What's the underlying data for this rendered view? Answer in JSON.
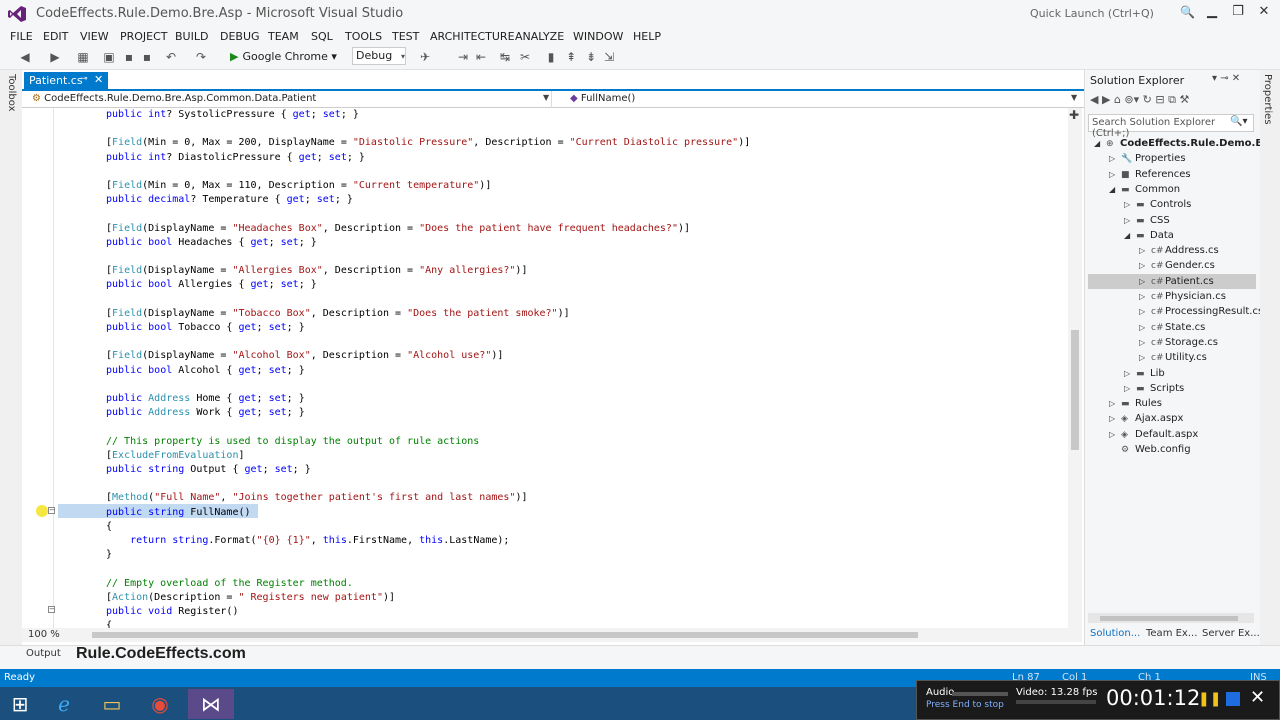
{
  "window": {
    "title": "CodeEffects.Rule.Demo.Bre.Asp - Microsoft Visual Studio",
    "quick_launch_placeholder": "Quick Launch (Ctrl+Q)"
  },
  "menu": [
    "FILE",
    "EDIT",
    "VIEW",
    "PROJECT",
    "BUILD",
    "DEBUG",
    "TEAM",
    "SQL",
    "TOOLS",
    "TEST",
    "ARCHITECTURE",
    "ANALYZE",
    "WINDOW",
    "HELP"
  ],
  "toolbar": {
    "run_target": "Google Chrome",
    "configuration": "Debug"
  },
  "left_tab": "Toolbox",
  "right_tab": "Properties",
  "editor": {
    "tab_label": "Patient.cs",
    "nav_left": "CodeEffects.Rule.Demo.Bre.Asp.Common.Data.Patient",
    "nav_right": "FullName()",
    "zoom": "100 %"
  },
  "code_lines": [
    {
      "text": "public int? SystolicPressure { get; set; }"
    },
    {
      "text": ""
    },
    {
      "text": "[Field(Min = 0, Max = 200, DisplayName = \"Diastolic Pressure\", Description = \"Current Diastolic pressure\")]"
    },
    {
      "text": "public int? DiastolicPressure { get; set; }"
    },
    {
      "text": ""
    },
    {
      "text": "[Field(Min = 0, Max = 110, Description = \"Current temperature\")]"
    },
    {
      "text": "public decimal? Temperature { get; set; }"
    },
    {
      "text": ""
    },
    {
      "text": "[Field(DisplayName = \"Headaches Box\", Description = \"Does the patient have frequent headaches?\")]"
    },
    {
      "text": "public bool Headaches { get; set; }"
    },
    {
      "text": ""
    },
    {
      "text": "[Field(DisplayName = \"Allergies Box\", Description = \"Any allergies?\")]"
    },
    {
      "text": "public bool Allergies { get; set; }"
    },
    {
      "text": ""
    },
    {
      "text": "[Field(DisplayName = \"Tobacco Box\", Description = \"Does the patient smoke?\")]"
    },
    {
      "text": "public bool Tobacco { get; set; }"
    },
    {
      "text": ""
    },
    {
      "text": "[Field(DisplayName = \"Alcohol Box\", Description = \"Alcohol use?\")]"
    },
    {
      "text": "public bool Alcohol { get; set; }"
    },
    {
      "text": ""
    },
    {
      "text": "public Address Home { get; set; }"
    },
    {
      "text": "public Address Work { get; set; }"
    },
    {
      "text": ""
    },
    {
      "text": "// This property is used to display the output of rule actions"
    },
    {
      "text": "[ExcludeFromEvaluation]"
    },
    {
      "text": "public string Output { get; set; }"
    },
    {
      "text": ""
    },
    {
      "text": "[Method(\"Full Name\", \"Joins together patient's first and last names\")]"
    },
    {
      "text": "public string FullName()"
    },
    {
      "text": "{"
    },
    {
      "text": "    return string.Format(\"{0} {1}\", this.FirstName, this.LastName);"
    },
    {
      "text": "}"
    },
    {
      "text": ""
    },
    {
      "text": "// Empty overload of the Register method."
    },
    {
      "text": "[Action(Description = \" Registers new patient\")]"
    },
    {
      "text": "public void Register()"
    },
    {
      "text": "{"
    }
  ],
  "solution_explorer": {
    "title": "Solution Explorer",
    "search_placeholder": "Search Solution Explorer (Ctrl+;)",
    "tree": [
      {
        "label": "CodeEffects.Rule.Demo.Bre.Asp",
        "level": 0,
        "arrow": "◢",
        "icon": "⊕",
        "bold": true
      },
      {
        "label": "Properties",
        "level": 1,
        "arrow": "▷",
        "icon": "🔧"
      },
      {
        "label": "References",
        "level": 1,
        "arrow": "▷",
        "icon": "■"
      },
      {
        "label": "Common",
        "level": 1,
        "arrow": "◢",
        "icon": "▬"
      },
      {
        "label": "Controls",
        "level": 2,
        "arrow": "▷",
        "icon": "▬"
      },
      {
        "label": "CSS",
        "level": 2,
        "arrow": "▷",
        "icon": "▬"
      },
      {
        "label": "Data",
        "level": 2,
        "arrow": "◢",
        "icon": "▬"
      },
      {
        "label": "Address.cs",
        "level": 3,
        "arrow": "▷",
        "icon": "c#"
      },
      {
        "label": "Gender.cs",
        "level": 3,
        "arrow": "▷",
        "icon": "c#"
      },
      {
        "label": "Patient.cs",
        "level": 3,
        "arrow": "▷",
        "icon": "c#",
        "selected": true
      },
      {
        "label": "Physician.cs",
        "level": 3,
        "arrow": "▷",
        "icon": "c#"
      },
      {
        "label": "ProcessingResult.cs",
        "level": 3,
        "arrow": "▷",
        "icon": "c#"
      },
      {
        "label": "State.cs",
        "level": 3,
        "arrow": "▷",
        "icon": "c#"
      },
      {
        "label": "Storage.cs",
        "level": 3,
        "arrow": "▷",
        "icon": "c#"
      },
      {
        "label": "Utility.cs",
        "level": 3,
        "arrow": "▷",
        "icon": "c#"
      },
      {
        "label": "Lib",
        "level": 2,
        "arrow": "▷",
        "icon": "▬"
      },
      {
        "label": "Scripts",
        "level": 2,
        "arrow": "▷",
        "icon": "▬"
      },
      {
        "label": "Rules",
        "level": 1,
        "arrow": "▷",
        "icon": "▬"
      },
      {
        "label": "Ajax.aspx",
        "level": 1,
        "arrow": "▷",
        "icon": "◈"
      },
      {
        "label": "Default.aspx",
        "level": 1,
        "arrow": "▷",
        "icon": "◈"
      },
      {
        "label": "Web.config",
        "level": 1,
        "arrow": "",
        "icon": "⚙"
      }
    ],
    "bottom_tabs": [
      "Solution...",
      "Team Ex...",
      "Server Ex..."
    ]
  },
  "output": {
    "tab_label": "Output",
    "banner": "Rule.CodeEffects.com"
  },
  "status": {
    "text": "Ready",
    "ln": "Ln 87",
    "col": "Col 1",
    "ch": "Ch 1",
    "mode": "INS"
  },
  "recorder": {
    "audio_label": "Audio",
    "video_label": "Video: 13.28 fps",
    "hint": "Press End to stop",
    "elapsed": "00:01:12"
  },
  "colors": {
    "accent": "#007acc",
    "keyword": "#0000ff",
    "string": "#a31515",
    "type": "#2b91af",
    "comment": "#008000",
    "selection": "#c2d9f2"
  }
}
